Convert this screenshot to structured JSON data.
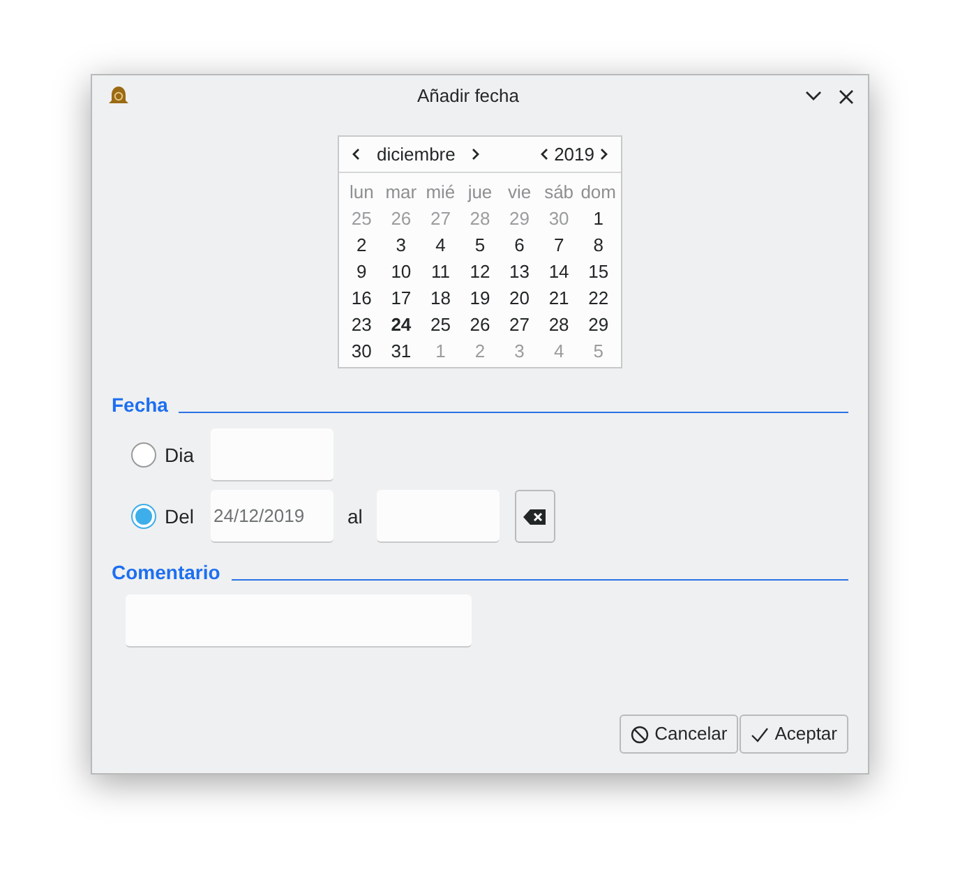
{
  "window": {
    "title": "Añadir fecha"
  },
  "calendar": {
    "month": "diciembre",
    "year": "2019",
    "weekdays": [
      "lun",
      "mar",
      "mié",
      "jue",
      "vie",
      "sáb",
      "dom"
    ],
    "days": [
      {
        "label": "25",
        "outside": true,
        "today": false
      },
      {
        "label": "26",
        "outside": true,
        "today": false
      },
      {
        "label": "27",
        "outside": true,
        "today": false
      },
      {
        "label": "28",
        "outside": true,
        "today": false
      },
      {
        "label": "29",
        "outside": true,
        "today": false
      },
      {
        "label": "30",
        "outside": true,
        "today": false
      },
      {
        "label": "1",
        "outside": false,
        "today": false
      },
      {
        "label": "2",
        "outside": false,
        "today": false
      },
      {
        "label": "3",
        "outside": false,
        "today": false
      },
      {
        "label": "4",
        "outside": false,
        "today": false
      },
      {
        "label": "5",
        "outside": false,
        "today": false
      },
      {
        "label": "6",
        "outside": false,
        "today": false
      },
      {
        "label": "7",
        "outside": false,
        "today": false
      },
      {
        "label": "8",
        "outside": false,
        "today": false
      },
      {
        "label": "9",
        "outside": false,
        "today": false
      },
      {
        "label": "10",
        "outside": false,
        "today": false
      },
      {
        "label": "11",
        "outside": false,
        "today": false
      },
      {
        "label": "12",
        "outside": false,
        "today": false
      },
      {
        "label": "13",
        "outside": false,
        "today": false
      },
      {
        "label": "14",
        "outside": false,
        "today": false
      },
      {
        "label": "15",
        "outside": false,
        "today": false
      },
      {
        "label": "16",
        "outside": false,
        "today": false
      },
      {
        "label": "17",
        "outside": false,
        "today": false
      },
      {
        "label": "18",
        "outside": false,
        "today": false
      },
      {
        "label": "19",
        "outside": false,
        "today": false
      },
      {
        "label": "20",
        "outside": false,
        "today": false
      },
      {
        "label": "21",
        "outside": false,
        "today": false
      },
      {
        "label": "22",
        "outside": false,
        "today": false
      },
      {
        "label": "23",
        "outside": false,
        "today": false
      },
      {
        "label": "24",
        "outside": false,
        "today": true
      },
      {
        "label": "25",
        "outside": false,
        "today": false
      },
      {
        "label": "26",
        "outside": false,
        "today": false
      },
      {
        "label": "27",
        "outside": false,
        "today": false
      },
      {
        "label": "28",
        "outside": false,
        "today": false
      },
      {
        "label": "29",
        "outside": false,
        "today": false
      },
      {
        "label": "30",
        "outside": false,
        "today": false
      },
      {
        "label": "31",
        "outside": false,
        "today": false
      },
      {
        "label": "1",
        "outside": true,
        "today": false
      },
      {
        "label": "2",
        "outside": true,
        "today": false
      },
      {
        "label": "3",
        "outside": true,
        "today": false
      },
      {
        "label": "4",
        "outside": true,
        "today": false
      },
      {
        "label": "5",
        "outside": true,
        "today": false
      }
    ]
  },
  "fecha": {
    "heading": "Fecha",
    "dia": {
      "label": "Dia",
      "selected": false
    },
    "del": {
      "label": "Del",
      "selected": true,
      "placeholder": "24/12/2019"
    },
    "al_label": "al"
  },
  "comentario": {
    "heading": "Comentario"
  },
  "buttons": [
    {
      "kind": "cancel",
      "label": "Cancelar"
    },
    {
      "kind": "accept",
      "label": "Aceptar"
    }
  ]
}
